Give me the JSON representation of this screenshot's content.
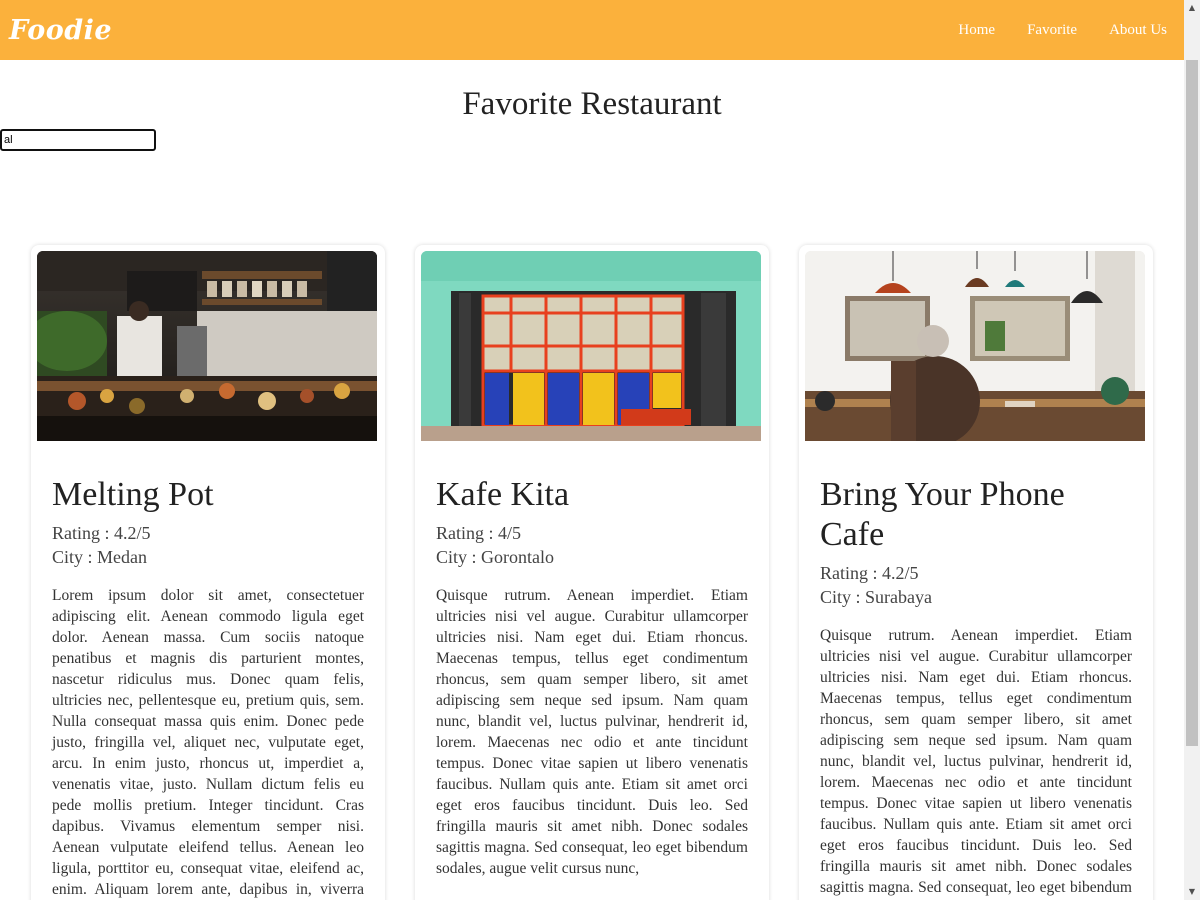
{
  "navbar": {
    "brand": "Foodie",
    "links": [
      "Home",
      "Favorite",
      "About Us"
    ],
    "color": "#fbb13c"
  },
  "page": {
    "title": "Favorite Restaurant"
  },
  "search": {
    "value": "al"
  },
  "restaurants": [
    {
      "name": "Melting Pot",
      "rating": "Rating : 4.2/5",
      "city": "City : Medan",
      "description": "Lorem ipsum dolor sit amet, consectetuer adipiscing elit. Aenean commodo ligula eget dolor. Aenean massa. Cum sociis natoque penatibus et magnis dis parturient montes, nascetur ridiculus mus. Donec quam felis, ultricies nec, pellentesque eu, pretium quis, sem. Nulla consequat massa quis enim. Donec pede justo, fringilla vel, aliquet nec, vulputate eget, arcu. In enim justo, rhoncus ut, imperdiet a, venenatis vitae, justo. Nullam dictum felis eu pede mollis pretium. Integer tincidunt. Cras dapibus. Vivamus elementum semper nisi. Aenean vulputate eleifend tellus. Aenean leo ligula, porttitor eu, consequat vitae, eleifend ac, enim. Aliquam lorem ante, dapibus in, viverra quis, feugiat a, tellus. Phasellus viverra nulla ut metus"
    },
    {
      "name": "Kafe Kita",
      "rating": "Rating : 4/5",
      "city": "City : Gorontalo",
      "description": "Quisque rutrum. Aenean imperdiet. Etiam ultricies nisi vel augue. Curabitur ullamcorper ultricies nisi. Nam eget dui. Etiam rhoncus. Maecenas tempus, tellus eget condimentum rhoncus, sem quam semper libero, sit amet adipiscing sem neque sed ipsum. Nam quam nunc, blandit vel, luctus pulvinar, hendrerit id, lorem. Maecenas nec odio et ante tincidunt tempus. Donec vitae sapien ut libero venenatis faucibus. Nullam quis ante. Etiam sit amet orci eget eros faucibus tincidunt. Duis leo. Sed fringilla mauris sit amet nibh. Donec sodales sagittis magna. Sed consequat, leo eget bibendum sodales, augue velit cursus nunc,"
    },
    {
      "name": "Bring Your Phone Cafe",
      "rating": "Rating : 4.2/5",
      "city": "City : Surabaya",
      "description": "Quisque rutrum. Aenean imperdiet. Etiam ultricies nisi vel augue. Curabitur ullamcorper ultricies nisi. Nam eget dui. Etiam rhoncus. Maecenas tempus, tellus eget condimentum rhoncus, sem quam semper libero, sit amet adipiscing sem neque sed ipsum. Nam quam nunc, blandit vel, luctus pulvinar, hendrerit id, lorem. Maecenas nec odio et ante tincidunt tempus. Donec vitae sapien ut libero venenatis faucibus. Nullam quis ante. Etiam sit amet orci eget eros faucibus tincidunt. Duis leo. Sed fringilla mauris sit amet nibh. Donec sodales sagittis magna. Sed consequat, leo eget bibendum sodales, augue velit cursus nunc,"
    }
  ]
}
